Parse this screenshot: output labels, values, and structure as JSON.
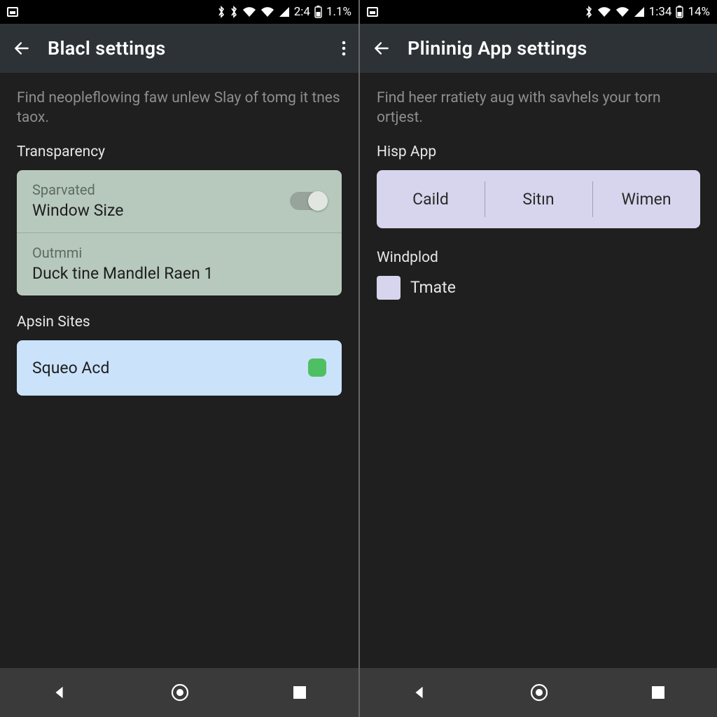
{
  "left": {
    "status": {
      "time": "2:4",
      "battery": "1.1%"
    },
    "appbar": {
      "title": "Blacl settings"
    },
    "description": "Find neopleflowing faw unlew Slay of tomg it tnes taox.",
    "section1_label": "Transparency",
    "row1": {
      "sub": "Sparvated",
      "main": "Window Size"
    },
    "row2": {
      "sub": "Outmmi",
      "main": "Duck tine Mandlel Raen 1"
    },
    "section2_label": "Apsin Sites",
    "site": {
      "name": "Squeo Acd"
    }
  },
  "right": {
    "status": {
      "time": "1:34",
      "battery": "14%"
    },
    "appbar": {
      "title": "Plininig App settings"
    },
    "description": "Find heer rratiety aug with savhels your torn ortjest.",
    "section1_label": "Hisp App",
    "segments": [
      "Caild",
      "Sitın",
      "Wimen"
    ],
    "section2_label": "Windplod",
    "checkbox_label": "Tmate"
  },
  "colors": {
    "green_card": "#b7c9bd",
    "blue_card": "#cbe2fb",
    "lav_card": "#d7d5ed",
    "accent_green": "#4fbf63"
  }
}
